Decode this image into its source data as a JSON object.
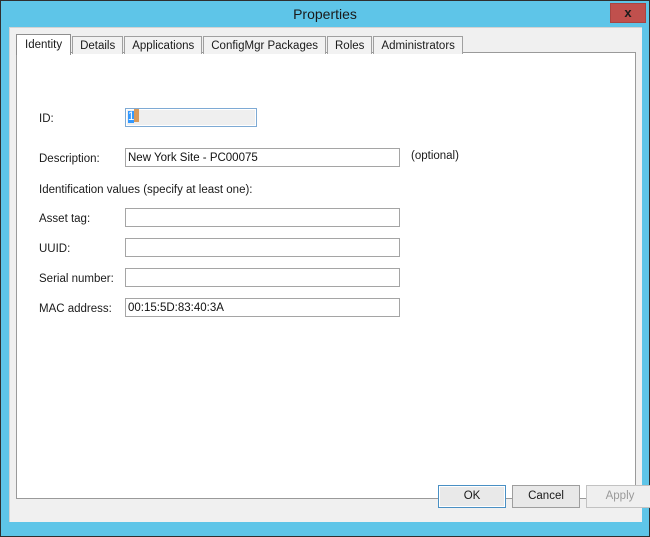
{
  "window": {
    "title": "Properties",
    "close_label": "x",
    "close_icon": "close-icon",
    "titlebar_color": "#5ec5e8",
    "close_button_color": "#c0504d"
  },
  "tabs": [
    {
      "label": "Identity",
      "active": true
    },
    {
      "label": "Details",
      "active": false
    },
    {
      "label": "Applications",
      "active": false
    },
    {
      "label": "ConfigMgr Packages",
      "active": false
    },
    {
      "label": "Roles",
      "active": false
    },
    {
      "label": "Administrators",
      "active": false
    }
  ],
  "identity": {
    "id": {
      "label": "ID:",
      "value": "1",
      "selected_text": "1",
      "readonly": true
    },
    "description": {
      "label": "Description:",
      "value": "New York Site - PC00075",
      "hint": "(optional)"
    },
    "section_heading": "Identification values (specify at least one):",
    "asset_tag": {
      "label": "Asset tag:",
      "value": ""
    },
    "uuid": {
      "label": "UUID:",
      "value": ""
    },
    "serial_number": {
      "label": "Serial number:",
      "value": ""
    },
    "mac_address": {
      "label": "MAC address:",
      "value": "00:15:5D:83:40:3A"
    }
  },
  "footer": {
    "ok": "OK",
    "cancel": "Cancel",
    "apply": "Apply",
    "apply_disabled": true
  }
}
